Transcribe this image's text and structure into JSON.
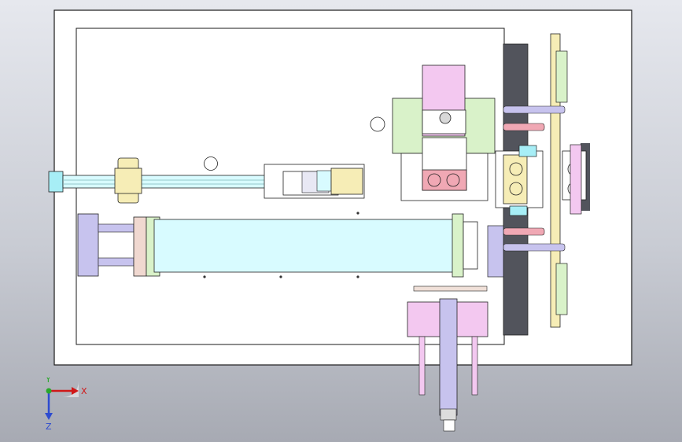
{
  "viewport": {
    "background_top": "#e6e8ee",
    "background_bottom": "#a7aab3"
  },
  "palette": {
    "plate": "#ffffff",
    "outline": "#1a1a1a",
    "cyan": "#d8fbff",
    "green": "#d9f2c9",
    "pink": "#f3c8f0",
    "salmon": "#f0a8b4",
    "lavender": "#c7c3ee",
    "yellow": "#f6edb6",
    "dark": "#52545c"
  },
  "triad": {
    "x_label": "X",
    "y_label": "Y",
    "z_label": "Z"
  }
}
